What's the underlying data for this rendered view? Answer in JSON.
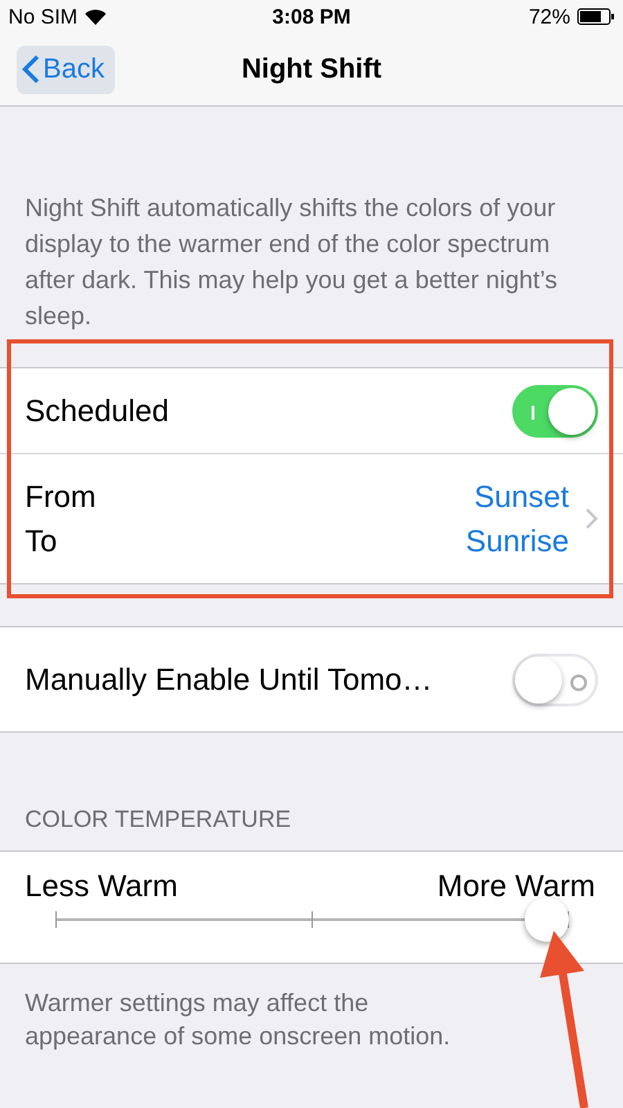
{
  "status_bar": {
    "carrier": "No SIM",
    "time": "3:08 PM",
    "battery": "72%"
  },
  "nav": {
    "back": "Back",
    "title": "Night Shift"
  },
  "description": "Night Shift automatically shifts the colors of your display to the warmer end of the color spectrum after dark. This may help you get a better night’s sleep.",
  "schedule": {
    "label": "Scheduled",
    "on": true,
    "from_label": "From",
    "to_label": "To",
    "from_value": "Sunset",
    "to_value": "Sunrise"
  },
  "manual": {
    "label": "Manually Enable Until Tomo…",
    "on": false
  },
  "color_temperature": {
    "header": "COLOR TEMPERATURE",
    "min_label": "Less Warm",
    "max_label": "More Warm",
    "level": 0.96
  },
  "footer": "Warmer settings may affect the appearance of some onscreen motion."
}
